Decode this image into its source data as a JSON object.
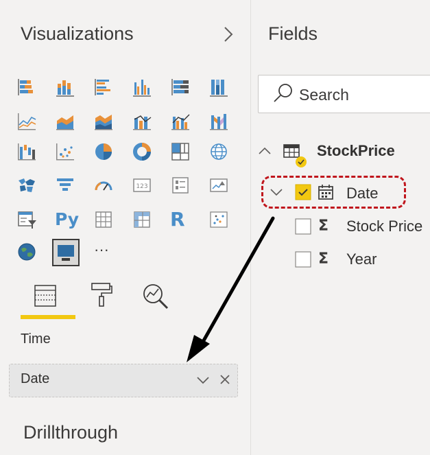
{
  "visualizations": {
    "title": "Visualizations",
    "more_label": "···",
    "chart_icons": [
      "stacked-bar-chart-icon",
      "stacked-column-chart-icon",
      "clustered-bar-chart-icon",
      "clustered-column-chart-icon",
      "100-percent-stacked-bar-chart-icon",
      "100-percent-stacked-column-chart-icon",
      "line-chart-icon",
      "area-chart-icon",
      "stacked-area-chart-icon",
      "line-and-stacked-column-chart-icon",
      "line-and-clustered-column-chart-icon",
      "ribbon-chart-icon",
      "waterfall-chart-icon",
      "scatter-chart-icon",
      "pie-chart-icon",
      "donut-chart-icon",
      "treemap-icon",
      "map-icon",
      "filled-map-icon",
      "funnel-icon",
      "gauge-icon",
      "card-icon",
      "multi-row-card-icon",
      "kpi-icon",
      "slicer-icon",
      "python-visual-icon",
      "table-icon",
      "matrix-icon",
      "r-script-visual-icon",
      "key-influencers-icon",
      "arcgis-map-icon",
      "custom-visual-icon",
      "get-more-visuals-icon"
    ],
    "python_label": "Py",
    "r_label": "R",
    "tabs": [
      "fields-tab-icon",
      "format-paint-roller-icon",
      "analytics-magnifier-icon"
    ],
    "time_label": "Time",
    "time_well_value": "Date",
    "drillthrough_title": "Drillthrough"
  },
  "fields": {
    "title": "Fields",
    "search_placeholder": "Search",
    "table_name": "StockPrice",
    "items": [
      {
        "label": "Date",
        "checked": true,
        "type": "calendar-icon"
      },
      {
        "label": "Stock Price",
        "checked": false,
        "type": "sigma-icon"
      },
      {
        "label": "Year",
        "checked": false,
        "type": "sigma-icon"
      }
    ]
  },
  "colors": {
    "accent_yellow": "#f2c811",
    "highlight_red": "#c0161d",
    "icon_blue": "#4a8ec8",
    "icon_orange": "#e8913a",
    "pane_bg": "#f3f2f1"
  }
}
